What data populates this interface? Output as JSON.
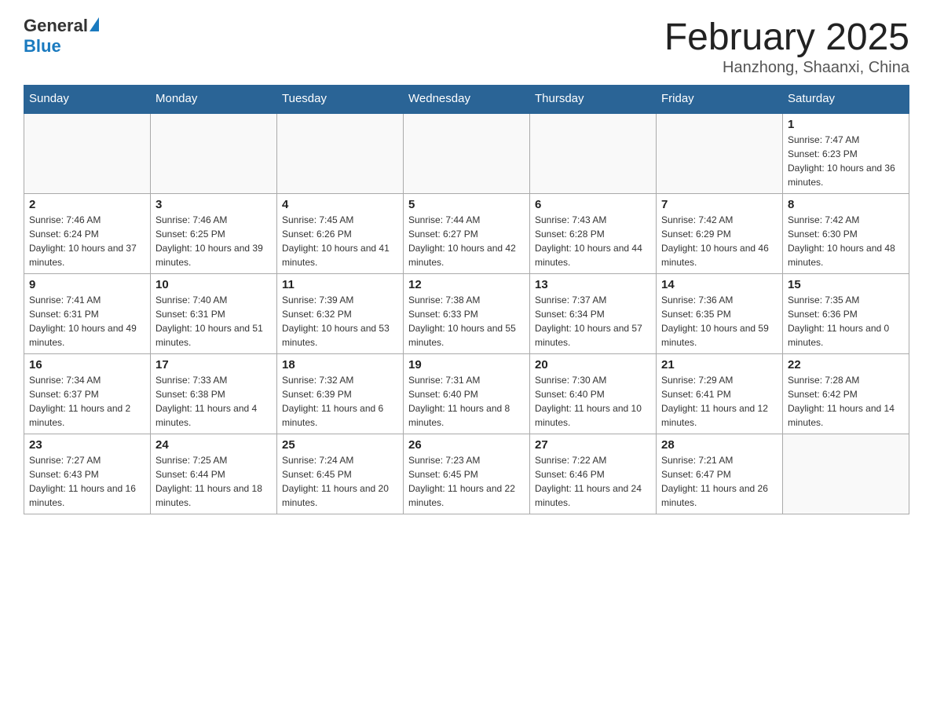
{
  "header": {
    "logo_general": "General",
    "logo_blue": "Blue",
    "month_title": "February 2025",
    "location": "Hanzhong, Shaanxi, China"
  },
  "days_of_week": [
    "Sunday",
    "Monday",
    "Tuesday",
    "Wednesday",
    "Thursday",
    "Friday",
    "Saturday"
  ],
  "weeks": [
    [
      {
        "day": "",
        "info": ""
      },
      {
        "day": "",
        "info": ""
      },
      {
        "day": "",
        "info": ""
      },
      {
        "day": "",
        "info": ""
      },
      {
        "day": "",
        "info": ""
      },
      {
        "day": "",
        "info": ""
      },
      {
        "day": "1",
        "info": "Sunrise: 7:47 AM\nSunset: 6:23 PM\nDaylight: 10 hours and 36 minutes."
      }
    ],
    [
      {
        "day": "2",
        "info": "Sunrise: 7:46 AM\nSunset: 6:24 PM\nDaylight: 10 hours and 37 minutes."
      },
      {
        "day": "3",
        "info": "Sunrise: 7:46 AM\nSunset: 6:25 PM\nDaylight: 10 hours and 39 minutes."
      },
      {
        "day": "4",
        "info": "Sunrise: 7:45 AM\nSunset: 6:26 PM\nDaylight: 10 hours and 41 minutes."
      },
      {
        "day": "5",
        "info": "Sunrise: 7:44 AM\nSunset: 6:27 PM\nDaylight: 10 hours and 42 minutes."
      },
      {
        "day": "6",
        "info": "Sunrise: 7:43 AM\nSunset: 6:28 PM\nDaylight: 10 hours and 44 minutes."
      },
      {
        "day": "7",
        "info": "Sunrise: 7:42 AM\nSunset: 6:29 PM\nDaylight: 10 hours and 46 minutes."
      },
      {
        "day": "8",
        "info": "Sunrise: 7:42 AM\nSunset: 6:30 PM\nDaylight: 10 hours and 48 minutes."
      }
    ],
    [
      {
        "day": "9",
        "info": "Sunrise: 7:41 AM\nSunset: 6:31 PM\nDaylight: 10 hours and 49 minutes."
      },
      {
        "day": "10",
        "info": "Sunrise: 7:40 AM\nSunset: 6:31 PM\nDaylight: 10 hours and 51 minutes."
      },
      {
        "day": "11",
        "info": "Sunrise: 7:39 AM\nSunset: 6:32 PM\nDaylight: 10 hours and 53 minutes."
      },
      {
        "day": "12",
        "info": "Sunrise: 7:38 AM\nSunset: 6:33 PM\nDaylight: 10 hours and 55 minutes."
      },
      {
        "day": "13",
        "info": "Sunrise: 7:37 AM\nSunset: 6:34 PM\nDaylight: 10 hours and 57 minutes."
      },
      {
        "day": "14",
        "info": "Sunrise: 7:36 AM\nSunset: 6:35 PM\nDaylight: 10 hours and 59 minutes."
      },
      {
        "day": "15",
        "info": "Sunrise: 7:35 AM\nSunset: 6:36 PM\nDaylight: 11 hours and 0 minutes."
      }
    ],
    [
      {
        "day": "16",
        "info": "Sunrise: 7:34 AM\nSunset: 6:37 PM\nDaylight: 11 hours and 2 minutes."
      },
      {
        "day": "17",
        "info": "Sunrise: 7:33 AM\nSunset: 6:38 PM\nDaylight: 11 hours and 4 minutes."
      },
      {
        "day": "18",
        "info": "Sunrise: 7:32 AM\nSunset: 6:39 PM\nDaylight: 11 hours and 6 minutes."
      },
      {
        "day": "19",
        "info": "Sunrise: 7:31 AM\nSunset: 6:40 PM\nDaylight: 11 hours and 8 minutes."
      },
      {
        "day": "20",
        "info": "Sunrise: 7:30 AM\nSunset: 6:40 PM\nDaylight: 11 hours and 10 minutes."
      },
      {
        "day": "21",
        "info": "Sunrise: 7:29 AM\nSunset: 6:41 PM\nDaylight: 11 hours and 12 minutes."
      },
      {
        "day": "22",
        "info": "Sunrise: 7:28 AM\nSunset: 6:42 PM\nDaylight: 11 hours and 14 minutes."
      }
    ],
    [
      {
        "day": "23",
        "info": "Sunrise: 7:27 AM\nSunset: 6:43 PM\nDaylight: 11 hours and 16 minutes."
      },
      {
        "day": "24",
        "info": "Sunrise: 7:25 AM\nSunset: 6:44 PM\nDaylight: 11 hours and 18 minutes."
      },
      {
        "day": "25",
        "info": "Sunrise: 7:24 AM\nSunset: 6:45 PM\nDaylight: 11 hours and 20 minutes."
      },
      {
        "day": "26",
        "info": "Sunrise: 7:23 AM\nSunset: 6:45 PM\nDaylight: 11 hours and 22 minutes."
      },
      {
        "day": "27",
        "info": "Sunrise: 7:22 AM\nSunset: 6:46 PM\nDaylight: 11 hours and 24 minutes."
      },
      {
        "day": "28",
        "info": "Sunrise: 7:21 AM\nSunset: 6:47 PM\nDaylight: 11 hours and 26 minutes."
      },
      {
        "day": "",
        "info": ""
      }
    ]
  ]
}
